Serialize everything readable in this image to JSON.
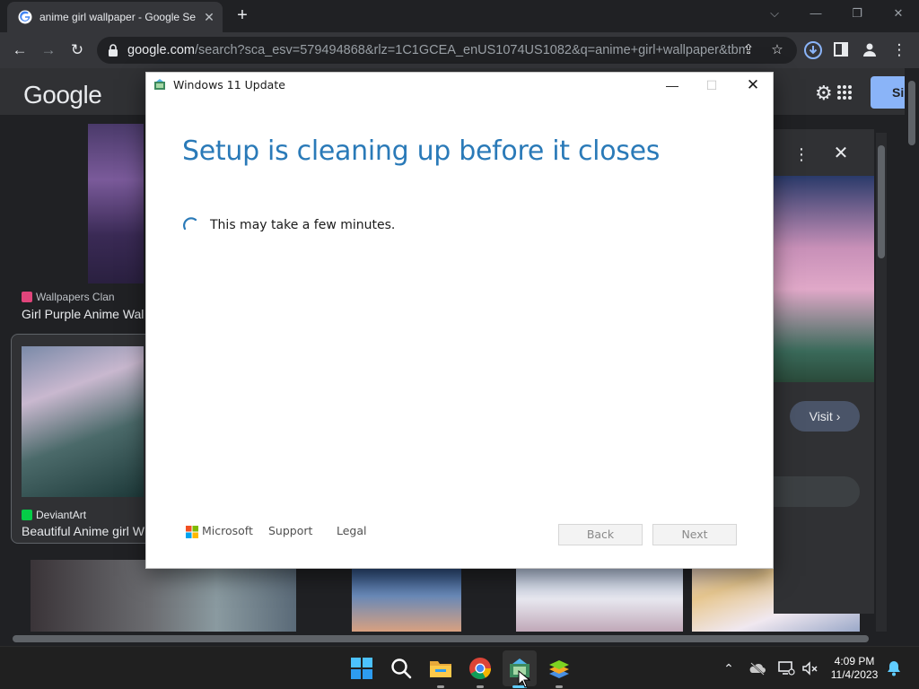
{
  "browser": {
    "tab_title": "anime girl wallpaper - Google Se",
    "url_host": "google.com",
    "url_rest": "/search?sca_esv=579494868&rlz=1C1GCEA_enUS1074US1082&q=anime+girl+wallpaper&tbm..."
  },
  "page": {
    "logo_text": "Google",
    "signin_label": "Si",
    "results": [
      {
        "source": "Wallpapers Clan",
        "caption": "Girl Purple Anime Wal"
      },
      {
        "source": "DeviantArt",
        "caption": "Beautiful Anime girl W"
      }
    ],
    "visit_label": "Visit"
  },
  "dialog": {
    "title": "Windows 11 Update",
    "heading": "Setup is cleaning up before it closes",
    "message": "This may take a few minutes.",
    "brand": "Microsoft",
    "links": [
      "Support",
      "Legal"
    ],
    "back_label": "Back",
    "next_label": "Next"
  },
  "taskbar": {
    "time": "4:09 PM",
    "date": "11/4/2023"
  },
  "colors": {
    "accent": "#2a7ab8",
    "browser_bg": "#202124",
    "toolbar_bg": "#35363a"
  }
}
